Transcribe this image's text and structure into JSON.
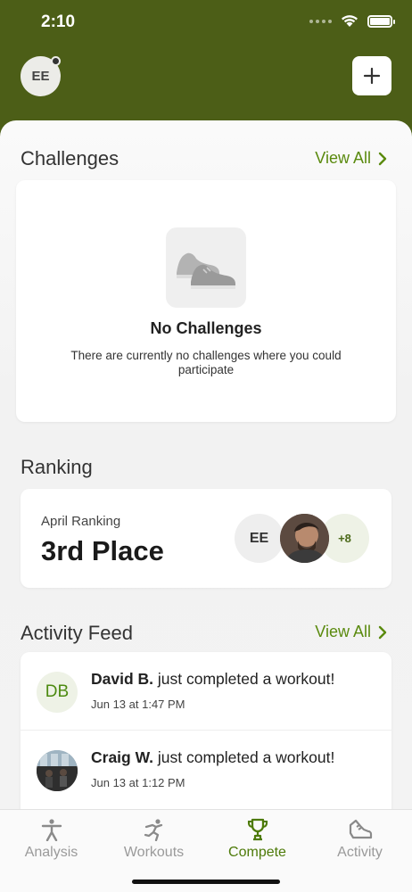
{
  "status_bar": {
    "time": "2:10"
  },
  "header": {
    "avatar_initials": "EE"
  },
  "challenges": {
    "title": "Challenges",
    "view_all": "View All",
    "empty_title": "No Challenges",
    "empty_text": "There are currently no challenges where you could participate"
  },
  "ranking": {
    "title": "Ranking",
    "label": "April Ranking",
    "value": "3rd Place",
    "avatar_initials": "EE",
    "more_count": "+8"
  },
  "feed": {
    "title": "Activity Feed",
    "view_all": "View All",
    "items": [
      {
        "name": "David B.",
        "action": " just completed a workout!",
        "time": "Jun 13 at 1:47 PM",
        "initials": "DB"
      },
      {
        "name": "Craig W.",
        "action": " just completed a workout!",
        "time": "Jun 13 at 1:12 PM"
      }
    ]
  },
  "tabs": [
    {
      "label": "Analysis",
      "icon": "person-icon"
    },
    {
      "label": "Workouts",
      "icon": "running-icon"
    },
    {
      "label": "Compete",
      "icon": "trophy-icon",
      "active": true
    },
    {
      "label": "Activity",
      "icon": "shoe-icon"
    }
  ],
  "colors": {
    "brand": "#4c5e17",
    "accent": "#5a8a0e"
  }
}
